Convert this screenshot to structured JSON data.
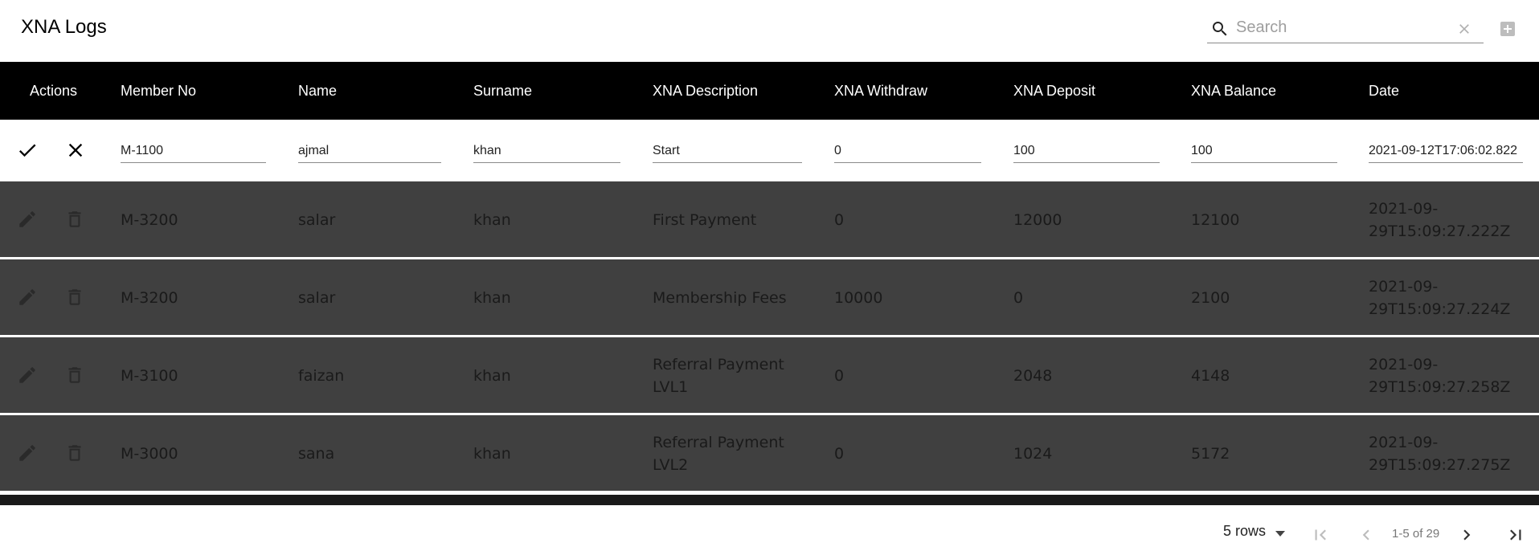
{
  "toolbar": {
    "title": "XNA Logs",
    "search": {
      "placeholder": "Search",
      "value": "",
      "search_icon": "search-icon",
      "clear_icon": "close-icon"
    },
    "add_icon": "add-box-icon"
  },
  "table": {
    "columns": [
      "Actions",
      "Member No",
      "Name",
      "Surname",
      "XNA Description",
      "XNA Withdraw",
      "XNA Deposit",
      "XNA Balance",
      "Date"
    ],
    "edit_row": {
      "confirm_icon": "check-icon",
      "cancel_icon": "close-icon",
      "member_no": "M-1100",
      "name": "ajmal",
      "surname": "khan",
      "description": "Start",
      "withdraw": "0",
      "deposit": "100",
      "balance": "100",
      "date": "2021-09-12T17:06:02.822"
    },
    "rows": [
      {
        "member_no": "M-3200",
        "name": "salar",
        "surname": "khan",
        "description_1": "First Payment",
        "description_2": "",
        "withdraw": "0",
        "deposit": "12000",
        "balance": "12100",
        "date_1": "2021-09-",
        "date_2": "29T15:09:27.222Z"
      },
      {
        "member_no": "M-3200",
        "name": "salar",
        "surname": "khan",
        "description_1": "Membership Fees",
        "description_2": "",
        "withdraw": "10000",
        "deposit": "0",
        "balance": "2100",
        "date_1": "2021-09-",
        "date_2": "29T15:09:27.224Z"
      },
      {
        "member_no": "M-3100",
        "name": "faizan",
        "surname": "khan",
        "description_1": "Referral Payment",
        "description_2": "LVL1",
        "withdraw": "0",
        "deposit": "2048",
        "balance": "4148",
        "date_1": "2021-09-",
        "date_2": "29T15:09:27.258Z"
      },
      {
        "member_no": "M-3000",
        "name": "sana",
        "surname": "khan",
        "description_1": "Referral Payment",
        "description_2": "LVL2",
        "withdraw": "0",
        "deposit": "1024",
        "balance": "5172",
        "date_1": "2021-09-",
        "date_2": "29T15:09:27.275Z"
      }
    ],
    "row_action_icons": [
      "edit-icon",
      "delete-icon"
    ]
  },
  "pagination": {
    "rows_per_page": "5 rows",
    "range": "1-5 of 29",
    "icons": [
      "first-page-icon",
      "previous-page-icon",
      "next-page-icon",
      "last-page-icon"
    ]
  },
  "colors": {
    "header_bg": "#000000",
    "disabled_row_bg": "#404040",
    "row_text": "#1a1a1a"
  }
}
